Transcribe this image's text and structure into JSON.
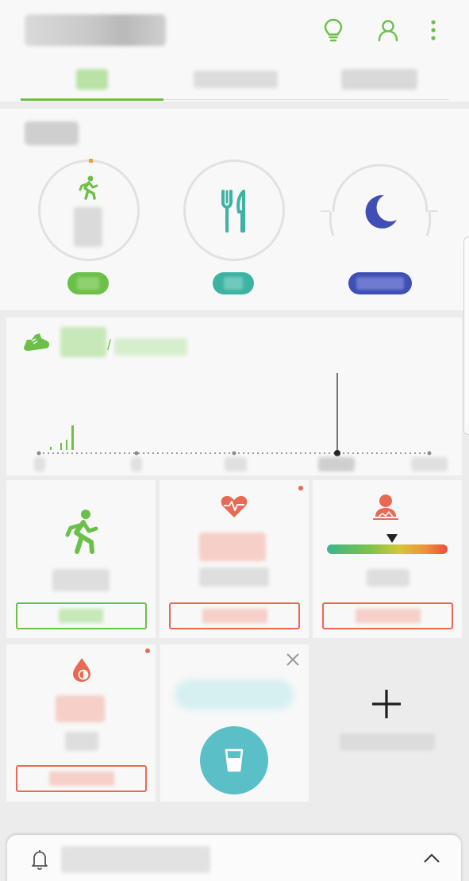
{
  "header": {
    "title": "",
    "icons": [
      "lightbulb-icon",
      "profile-icon",
      "more-vert-icon"
    ],
    "tabs": [
      {
        "label": "",
        "active": true
      },
      {
        "label": "",
        "active": false
      },
      {
        "label": "",
        "active": false
      }
    ]
  },
  "summary": {
    "title": "",
    "rings": [
      {
        "icon": "running-icon",
        "value": "",
        "button": "",
        "color": "#6cc04a"
      },
      {
        "icon": "fork-knife-icon",
        "value": "",
        "button": "",
        "color": "#3db3a3"
      },
      {
        "icon": "moon-icon",
        "value": "",
        "button": "",
        "color": "#3f4fb5"
      }
    ]
  },
  "steps": {
    "icon": "shoe-icon",
    "count": "",
    "separator": "/",
    "goal": "",
    "axis_labels": [
      "",
      "",
      "",
      "",
      ""
    ]
  },
  "tiles": [
    {
      "name": "exercise",
      "icon": "running-icon",
      "label": "",
      "button": "",
      "accent": "#6cc04a"
    },
    {
      "name": "heart-rate",
      "icon": "heart-rate-icon",
      "value": "",
      "label": "",
      "button": "",
      "accent": "#e86a55"
    },
    {
      "name": "stress",
      "icon": "stress-icon",
      "label": "",
      "button": "",
      "accent": "#e86a55"
    },
    {
      "name": "blood-oxygen",
      "icon": "blood-drop-icon",
      "value": "",
      "label": "",
      "button": "",
      "accent": "#e86a55"
    },
    {
      "name": "water",
      "icon": "water-cup-icon",
      "label": "",
      "accent": "#5bbfc8"
    },
    {
      "name": "add",
      "icon": "plus-icon",
      "label": ""
    }
  ],
  "notification": {
    "text": ""
  },
  "colors": {
    "green": "#6cc04a",
    "teal": "#3db3a3",
    "indigo": "#3f4fb5",
    "coral": "#e86a55",
    "cyan": "#5bbfc8"
  }
}
